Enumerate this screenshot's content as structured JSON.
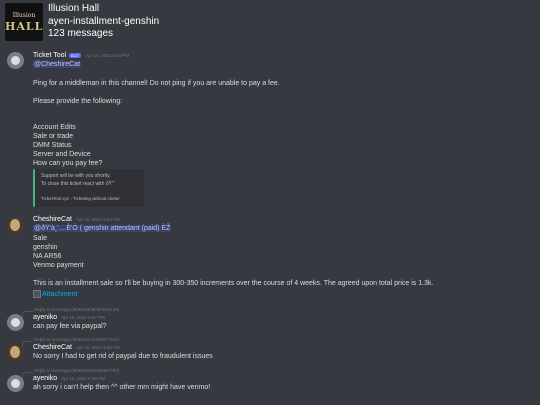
{
  "header": {
    "server_icon_line1": "Illusion",
    "server_icon_line2": "HALL",
    "server_name": "Illusion Hall",
    "channel_name": "ayen-installment-genshin",
    "message_count": "123 messages"
  },
  "messages": [
    {
      "author": "Ticket Tool",
      "badge": "BOT",
      "timestamp": "Apr 16, 2022 6:34 PM",
      "lines": [
        "@CheshireCat",
        "Ping for a middleman in this channel!  Do not ping if you are unable to pay a fee.",
        "Please provide the following:",
        "Account Edits",
        "Sale or trade",
        "DMM Status",
        "Server and Device",
        "How can you pay fee?"
      ],
      "embed": {
        "line1": "Support will be with you shortly.",
        "line2": "To close this ticket react with ðŸ”’",
        "footer": "TicketTool.xyz - Ticketing without clutter"
      }
    },
    {
      "author": "CheshireCat",
      "timestamp": "Apr 16, 2022 6:53 PM",
      "lines": [
        "@ðŸ'­à¸'....È'Ò ( genshin attendant (paid) ÈŽ",
        "Sale",
        "genshin",
        "NA AR56",
        "Venmo payment",
        "This is an installment sale so I'll be buying in 300-350 increments over the course of 4 weeks. The agreed upon total price is 1.3k.",
        "Attachment"
      ]
    },
    {
      "reply": "Reply to message (965043639397543125)",
      "author": "ayeniko",
      "timestamp": "Apr 16, 2022 6:57 PM",
      "lines": [
        "can pay fee via paypal?"
      ]
    },
    {
      "reply": "Reply to message (965044175426677842)",
      "author": "CheshireCat",
      "timestamp": "Apr 16, 2022 6:58 PM",
      "lines": [
        "No sorry I had to get rid of paypal due to fraudulent issues"
      ]
    },
    {
      "reply": "Reply to message (965045352686387780)",
      "author": "ayeniko",
      "timestamp": "Apr 16, 2022 6:59 PM",
      "lines": [
        "ah sorry i can't help then ^^ other mm might have venmo!"
      ]
    }
  ],
  "colors": {
    "background": "#36393f",
    "text": "#dcddde",
    "muted": "#72767d",
    "mention": "#b9c3ff",
    "link": "#00b0f4",
    "embed_border": "#43b581",
    "bot_badge": "#5865f2"
  }
}
